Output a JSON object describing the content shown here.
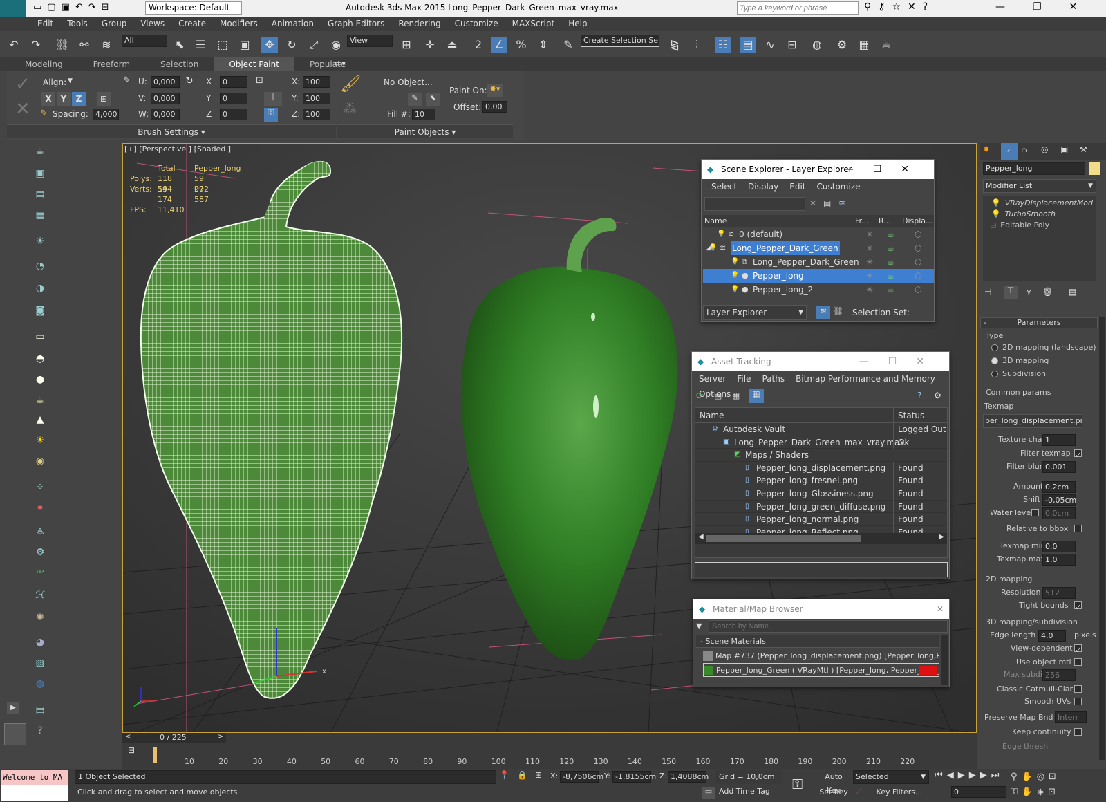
{
  "titlebar": {
    "workspace": "Workspace: Default",
    "title": "Autodesk 3ds Max  2015     Long_Pepper_Dark_Green_max_vray.max",
    "search_placeholder": "Type a keyword or phrase",
    "app_logo": "MAX"
  },
  "menu": [
    "Edit",
    "Tools",
    "Group",
    "Views",
    "Create",
    "Modifiers",
    "Animation",
    "Graph Editors",
    "Rendering",
    "Customize",
    "MAXScript",
    "Help"
  ],
  "toolbar": {
    "filter": "All",
    "ref_coord": "View",
    "selection_set": "Create Selection Se"
  },
  "ribbon": {
    "tabs": [
      "Modeling",
      "Freeform",
      "Selection",
      "Object Paint",
      "Populate"
    ],
    "active_tab": "Object Paint",
    "align_label": "Align:",
    "axes": [
      "X",
      "Y",
      "Z"
    ],
    "spacing_label": "Spacing:",
    "spacing": "4,000",
    "u_label": "U:",
    "u": "0,000",
    "v_label": "V:",
    "v": "0,000",
    "w_label": "W:",
    "w": "0,000",
    "x_label": "X",
    "x": "0",
    "y_label": "Y",
    "y": "0",
    "z_label": "Z",
    "z": "0",
    "sx_label": "X:",
    "sx": "100",
    "sy_label": "Y:",
    "sy": "100",
    "sz_label": "Z:",
    "sz": "100",
    "no_object": "No Object...",
    "fill_label": "Fill #:",
    "fill": "10",
    "paint_on_label": "Paint On:",
    "offset_label": "Offset:",
    "offset": "0,00",
    "brush_settings": "Brush Settings",
    "paint_objects": "Paint Objects"
  },
  "viewport": {
    "label": "[+] [Perspective ] [Shaded ]",
    "stats": {
      "col_total": "Total",
      "col_obj": "Pepper_long",
      "polys_label": "Polys:",
      "polys_total": "118 144",
      "polys_obj": "59 072",
      "verts_label": "Verts:",
      "verts_total": "59 174",
      "verts_obj": "29 587",
      "fps_label": "FPS:",
      "fps": "11,410"
    }
  },
  "scene_explorer": {
    "title": "Scene Explorer - Layer Explorer",
    "menu": [
      "Select",
      "Display",
      "Edit",
      "Customize"
    ],
    "columns": [
      "Name",
      "Fr...",
      "R...",
      "Displa..."
    ],
    "rows": [
      {
        "name": "0 (default)",
        "selected": false
      },
      {
        "name": "Long_Pepper_Dark_Green",
        "selected": false,
        "highlight": true
      },
      {
        "name": "Long_Pepper_Dark_Green",
        "selected": false
      },
      {
        "name": "Pepper_long",
        "selected": true
      },
      {
        "name": "Pepper_long_2",
        "selected": false
      }
    ],
    "footer_dropdown": "Layer Explorer",
    "selection_set_label": "Selection Set:"
  },
  "asset_tracking": {
    "title": "Asset Tracking",
    "menu": [
      "Server",
      "File",
      "Paths",
      "Bitmap Performance and Memory",
      "Options"
    ],
    "columns": [
      "Name",
      "Status"
    ],
    "rows": [
      {
        "name": "Autodesk Vault",
        "status": "Logged Out ...",
        "indent": 1
      },
      {
        "name": "Long_Pepper_Dark_Green_max_vray.max",
        "status": "Ok",
        "indent": 2
      },
      {
        "name": "Maps / Shaders",
        "status": "",
        "indent": 3
      },
      {
        "name": "Pepper_long_displacement.png",
        "status": "Found",
        "indent": 4
      },
      {
        "name": "Pepper_long_fresnel.png",
        "status": "Found",
        "indent": 4
      },
      {
        "name": "Pepper_long_Glossiness.png",
        "status": "Found",
        "indent": 4
      },
      {
        "name": "Pepper_long_green_diffuse.png",
        "status": "Found",
        "indent": 4
      },
      {
        "name": "Pepper_long_normal.png",
        "status": "Found",
        "indent": 4
      },
      {
        "name": "Pepper_long_Reflect.png",
        "status": "Found",
        "indent": 4
      }
    ]
  },
  "material_browser": {
    "title": "Material/Map Browser",
    "search_placeholder": "Search by Name ...",
    "section": "- Scene Materials",
    "items": [
      "Map #737 (Pepper_long_displacement.png) [Pepper_long,P...",
      "Pepper_long_Green  ( VRayMtl ) [Pepper_long, Pepper_long_..."
    ]
  },
  "command_panel": {
    "object_name": "Pepper_long",
    "modifier_list": "Modifier List",
    "stack": [
      "VRayDisplacementMod",
      "TurboSmooth",
      "Editable Poly"
    ],
    "parameters": "Parameters",
    "type_label": "Type",
    "types": [
      "2D mapping (landscape)",
      "3D mapping",
      "Subdivision"
    ],
    "selected_type": "3D mapping",
    "common": "Common params",
    "texmap_label": "Texmap",
    "texmap": "per_long_displacement.png)",
    "texture_chan_label": "Texture chan",
    "texture_chan": "1",
    "filter_texmap": "Filter texmap",
    "filter_blur_label": "Filter blur",
    "filter_blur": "0,001",
    "amount_label": "Amount",
    "amount": "0,2cm",
    "shift_label": "Shift",
    "shift": "-0,05cm",
    "water_label": "Water level",
    "water": "0,0cm",
    "relative": "Relative to bbox",
    "tmin_label": "Texmap min",
    "tmin": "0,0",
    "tmax_label": "Texmap max",
    "tmax": "1,0",
    "map2d": "2D mapping",
    "resolution_label": "Resolution",
    "resolution": "512",
    "tight": "Tight bounds",
    "map3d": "3D mapping/subdivision",
    "edge_label": "Edge length",
    "edge": "4,0",
    "pixels": "pixels",
    "view_dep": "View-dependent",
    "use_obj": "Use object mtl",
    "max_subdivs_label": "Max subdivs",
    "max_subdivs": "256",
    "catmull": "Classic Catmull-Clark",
    "smooth_uv": "Smooth UVs",
    "preserve_label": "Preserve Map Bnd",
    "preserve": "Interr",
    "keep": "Keep continuity",
    "edge_thresh": "Edge thresh"
  },
  "timeline": {
    "frame": "0 / 225",
    "ticks": [
      "10",
      "20",
      "30",
      "40",
      "50",
      "60",
      "70",
      "80",
      "90",
      "100",
      "110",
      "120",
      "130",
      "140",
      "150",
      "160",
      "170",
      "180",
      "190",
      "200",
      "210",
      "220"
    ]
  },
  "status": {
    "welcome": "Welcome to MA",
    "selected": "1 Object Selected",
    "prompt": "Click and drag to select and move objects",
    "x_label": "X:",
    "x": "-8,7506cm",
    "y_label": "Y:",
    "y": "-1,8155cm",
    "z_label": "Z:",
    "z": "1,4088cm",
    "grid": "Grid = 10,0cm",
    "add_time_tag": "Add Time Tag",
    "auto_key": "Auto Key",
    "set_key": "Set Key",
    "key_mode": "Selected",
    "key_filters": "Key Filters...",
    "frame": "0"
  }
}
